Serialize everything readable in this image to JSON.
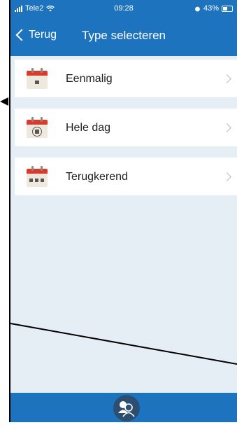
{
  "status": {
    "carrier": "Tele2",
    "time": "09:28",
    "battery": "43%"
  },
  "nav": {
    "back_label": "Terug",
    "title": "Type selecteren"
  },
  "items": [
    {
      "label": "Eenmalig"
    },
    {
      "label": "Hele dag"
    },
    {
      "label": "Terugkerend"
    }
  ],
  "colors": {
    "primary": "#1e73be",
    "background": "#e6eef5",
    "calendar_red": "#d93b2b",
    "fab": "#2c4e71"
  }
}
